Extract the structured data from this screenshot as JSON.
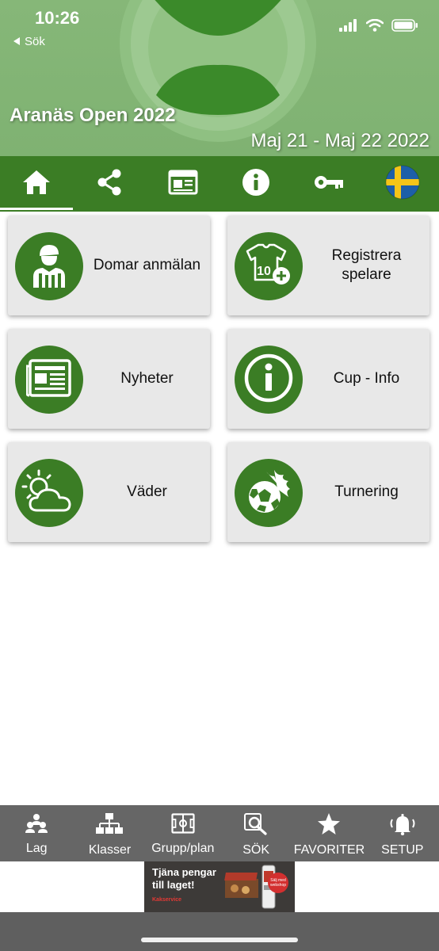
{
  "status_bar": {
    "time": "10:26",
    "back_label": "Sök"
  },
  "event": {
    "title": "Aranäs Open 2022",
    "dates": "Maj 21 - Maj 22 2022"
  },
  "colors": {
    "primary": "#3b7d25",
    "header_bg": "#82b575",
    "tile_bg": "#e8e8e8",
    "bottom_nav_bg": "#666666"
  },
  "tabs": [
    {
      "icon": "home-icon",
      "active": true
    },
    {
      "icon": "share-icon"
    },
    {
      "icon": "newspaper-icon"
    },
    {
      "icon": "info-icon"
    },
    {
      "icon": "key-icon"
    },
    {
      "icon": "sweden-flag-icon"
    }
  ],
  "tiles": [
    {
      "label": "Domar anmälan",
      "icon": "referee-icon"
    },
    {
      "label": "Registrera spelare",
      "icon": "player-jersey-add-icon",
      "badge": "10"
    },
    {
      "label": "Nyheter",
      "icon": "newspaper-icon"
    },
    {
      "label": "Cup - Info",
      "icon": "info-icon"
    },
    {
      "label": "Väder",
      "icon": "weather-icon"
    },
    {
      "label": "Turnering",
      "icon": "fire-ball-icon"
    }
  ],
  "bottom_nav": [
    {
      "label": "Lag",
      "icon": "team-icon"
    },
    {
      "label": "Klasser",
      "icon": "hierarchy-icon"
    },
    {
      "label": "Grupp/plan",
      "icon": "field-icon"
    },
    {
      "label": "SÖK",
      "icon": "search-icon"
    },
    {
      "label": "FAVORITER",
      "icon": "star-icon"
    },
    {
      "label": "SETUP",
      "icon": "bell-icon"
    }
  ],
  "ad": {
    "text": "Tjäna pengar till laget!",
    "brand": "Kakservice",
    "badge": "Sälj med webshop"
  }
}
